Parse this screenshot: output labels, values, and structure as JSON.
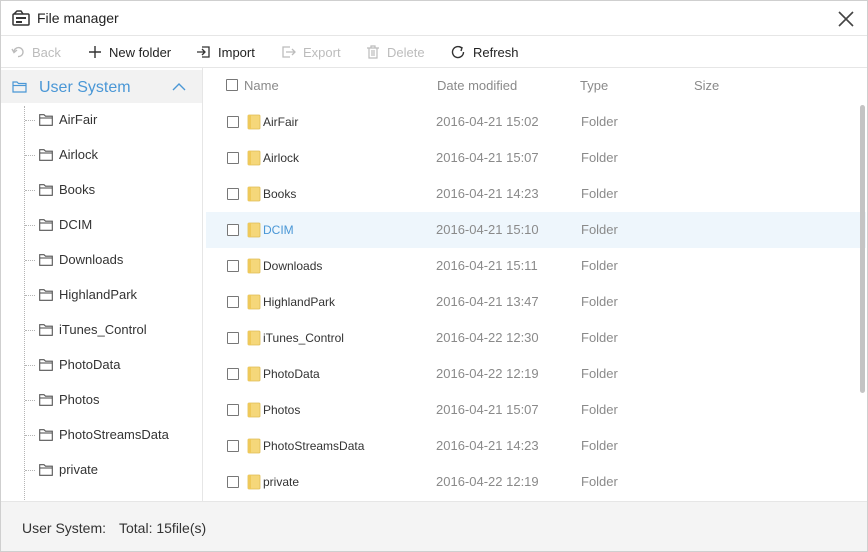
{
  "window": {
    "title": "File manager"
  },
  "toolbar": {
    "back_label": "Back",
    "new_folder_label": "New folder",
    "import_label": "Import",
    "export_label": "Export",
    "delete_label": "Delete",
    "refresh_label": "Refresh"
  },
  "sidebar": {
    "root_label": "User System",
    "items": [
      {
        "label": "AirFair"
      },
      {
        "label": "Airlock"
      },
      {
        "label": "Books"
      },
      {
        "label": "DCIM"
      },
      {
        "label": "Downloads"
      },
      {
        "label": "HighlandPark"
      },
      {
        "label": "iTunes_Control"
      },
      {
        "label": "PhotoData"
      },
      {
        "label": "Photos"
      },
      {
        "label": "PhotoStreamsData"
      },
      {
        "label": "private"
      }
    ]
  },
  "list": {
    "columns": {
      "name": "Name",
      "date": "Date modified",
      "type": "Type",
      "size": "Size"
    },
    "rows": [
      {
        "name": "AirFair",
        "date": "2016-04-21 15:02",
        "type": "Folder"
      },
      {
        "name": "Airlock",
        "date": "2016-04-21 15:07",
        "type": "Folder"
      },
      {
        "name": "Books",
        "date": "2016-04-21 14:23",
        "type": "Folder"
      },
      {
        "name": "DCIM",
        "date": "2016-04-21 15:10",
        "type": "Folder"
      },
      {
        "name": "Downloads",
        "date": "2016-04-21 15:11",
        "type": "Folder"
      },
      {
        "name": "HighlandPark",
        "date": "2016-04-21 13:47",
        "type": "Folder"
      },
      {
        "name": "iTunes_Control",
        "date": "2016-04-22 12:30",
        "type": "Folder"
      },
      {
        "name": "PhotoData",
        "date": "2016-04-22 12:19",
        "type": "Folder"
      },
      {
        "name": "Photos",
        "date": "2016-04-21 15:07",
        "type": "Folder"
      },
      {
        "name": "PhotoStreamsData",
        "date": "2016-04-21 14:23",
        "type": "Folder"
      },
      {
        "name": "private",
        "date": "2016-04-22 12:19",
        "type": "Folder"
      }
    ]
  },
  "status": {
    "label": "User System:",
    "total": "Total:  15file(s)"
  },
  "colors": {
    "accent": "#4a97d6",
    "folder": "#f5d77a",
    "selected_row": "#eef6fc"
  }
}
